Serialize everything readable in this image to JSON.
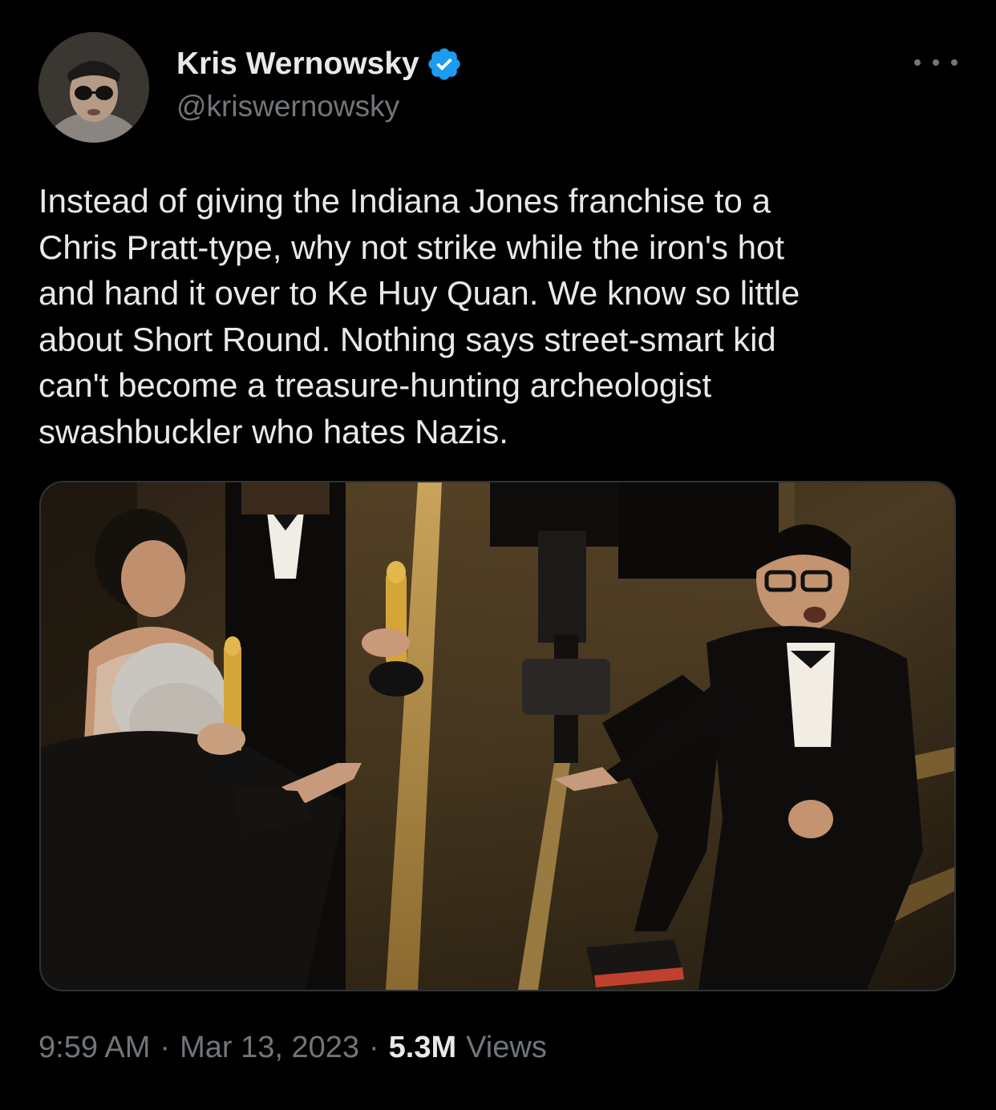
{
  "tweet": {
    "author": {
      "display_name": "Kris Wernowsky",
      "handle": "@kriswernowsky",
      "verified": true,
      "avatar_icon": "profile-photo"
    },
    "more_icon": "more-horizontal-icon",
    "text": "Instead of giving the Indiana Jones franchise to a\nChris Pratt-type, why not strike while the iron's hot\nand hand it over to Ke Huy Quan. We know so little\nabout Short Round. Nothing says street-smart kid\ncan't become a treasure-hunting archeologist\nswashbuckler who hates Nazis.",
    "media": {
      "type": "photo"
    },
    "meta": {
      "time": "9:59 AM",
      "separator": "·",
      "date": "Mar 13, 2023",
      "views_count": "5.3M",
      "views_label": "Views"
    }
  },
  "colors": {
    "background": "#000000",
    "primary_text": "#e7e9ea",
    "secondary_text": "#71767b",
    "verified_blue": "#1d9bf0",
    "border": "#2f3336"
  }
}
